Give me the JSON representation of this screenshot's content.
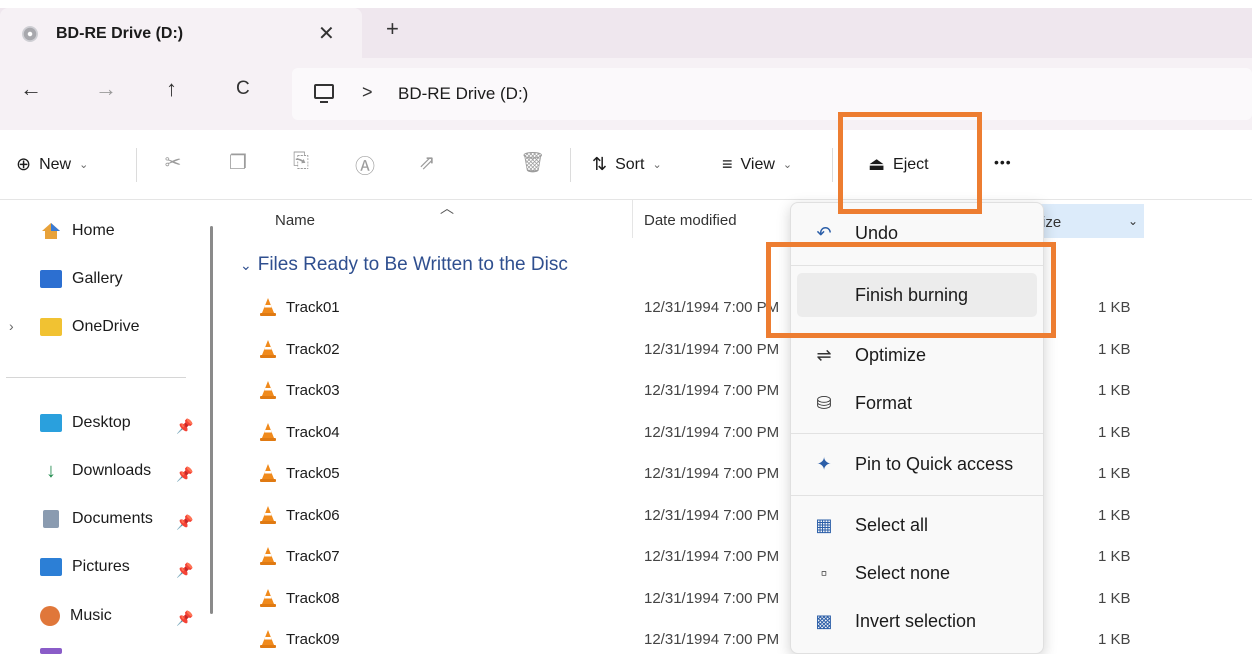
{
  "tab": {
    "title": "BD-RE Drive (D:)",
    "close": "✕",
    "new_tab": "+"
  },
  "nav": {
    "back": "←",
    "forward": "→",
    "up": "↑",
    "refresh": "C"
  },
  "address": {
    "separator": ">",
    "crumb": "BD-RE Drive (D:)"
  },
  "toolbar": {
    "new_label": "New",
    "sort_label": "Sort",
    "view_label": "View",
    "eject_label": "Eject",
    "more_label": "•••"
  },
  "sidebar": {
    "items": [
      {
        "label": "Home"
      },
      {
        "label": "Gallery"
      },
      {
        "label": "OneDrive"
      },
      {
        "label": "Desktop"
      },
      {
        "label": "Downloads"
      },
      {
        "label": "Documents"
      },
      {
        "label": "Pictures"
      },
      {
        "label": "Music"
      }
    ]
  },
  "columns": {
    "name": "Name",
    "date": "Date modified",
    "size": "ize"
  },
  "group": {
    "label": "Files Ready to Be Written to the Disc"
  },
  "files": [
    {
      "name": "Track01",
      "date": "12/31/1994 7:00 PM",
      "size": "1 KB"
    },
    {
      "name": "Track02",
      "date": "12/31/1994 7:00 PM",
      "size": "1 KB"
    },
    {
      "name": "Track03",
      "date": "12/31/1994 7:00 PM",
      "size": "1 KB"
    },
    {
      "name": "Track04",
      "date": "12/31/1994 7:00 PM",
      "size": "1 KB"
    },
    {
      "name": "Track05",
      "date": "12/31/1994 7:00 PM",
      "size": "1 KB"
    },
    {
      "name": "Track06",
      "date": "12/31/1994 7:00 PM",
      "size": "1 KB"
    },
    {
      "name": "Track07",
      "date": "12/31/1994 7:00 PM",
      "size": "1 KB"
    },
    {
      "name": "Track08",
      "date": "12/31/1994 7:00 PM",
      "size": "1 KB"
    },
    {
      "name": "Track09",
      "date": "12/31/1994 7:00 PM",
      "size": "1 KB"
    }
  ],
  "menu": {
    "undo": "Undo",
    "finish_burning": "Finish burning",
    "optimize": "Optimize",
    "format": "Format",
    "pin": "Pin to Quick access",
    "select_all": "Select all",
    "select_none": "Select none",
    "invert": "Invert selection"
  },
  "colors": {
    "accent": "#ed7d31",
    "group_text": "#2f4f8f",
    "menu_icon": "#2b5ea8"
  }
}
